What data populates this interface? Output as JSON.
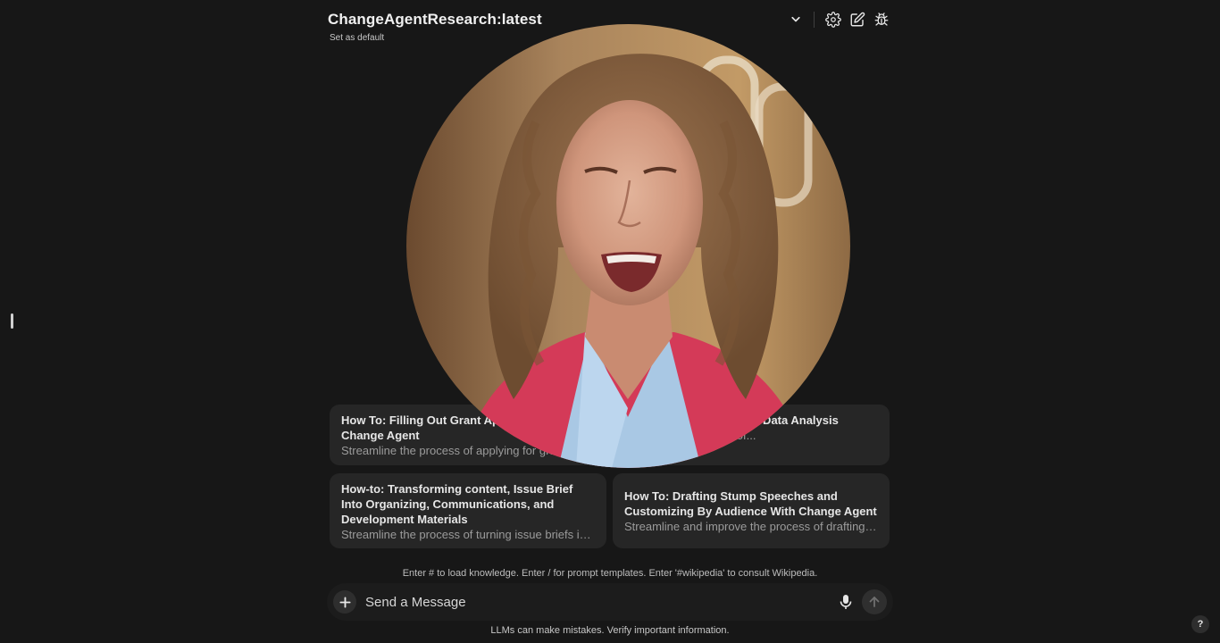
{
  "header": {
    "model_name": "ChangeAgentResearch:latest",
    "set_default_label": "Set as default",
    "icons": [
      "chevron-down-icon",
      "gear-icon",
      "edit-icon",
      "bug-icon"
    ]
  },
  "video": {
    "description_icon": "video-call-icon"
  },
  "suggestions": [
    {
      "title": "How To: Filling Out Grant Applications with Change Agent",
      "description": "Streamline the process of applying for grants..."
    },
    {
      "title": "How To: Comprehensive Data Analysis",
      "description": "Enhance the process of..."
    },
    {
      "title": "How-to: Transforming content, Issue Brief Into Organizing, Communications, and Development Materials",
      "description": "Streamline the process of turning issue briefs i…"
    },
    {
      "title": "How To: Drafting Stump Speeches and Customizing By Audience With Change Agent",
      "description": "Streamline and improve the process of drafting…"
    }
  ],
  "hint": "Enter # to load knowledge. Enter / for prompt templates. Enter '#wikipedia' to consult Wikipedia.",
  "input": {
    "placeholder": "Send a Message",
    "value": ""
  },
  "disclaimer": "LLMs can make mistakes. Verify important information.",
  "help_label": "?",
  "colors": {
    "background": "#171717",
    "card": "#262626",
    "text": "#ececec",
    "muted": "#9b9b9b"
  }
}
